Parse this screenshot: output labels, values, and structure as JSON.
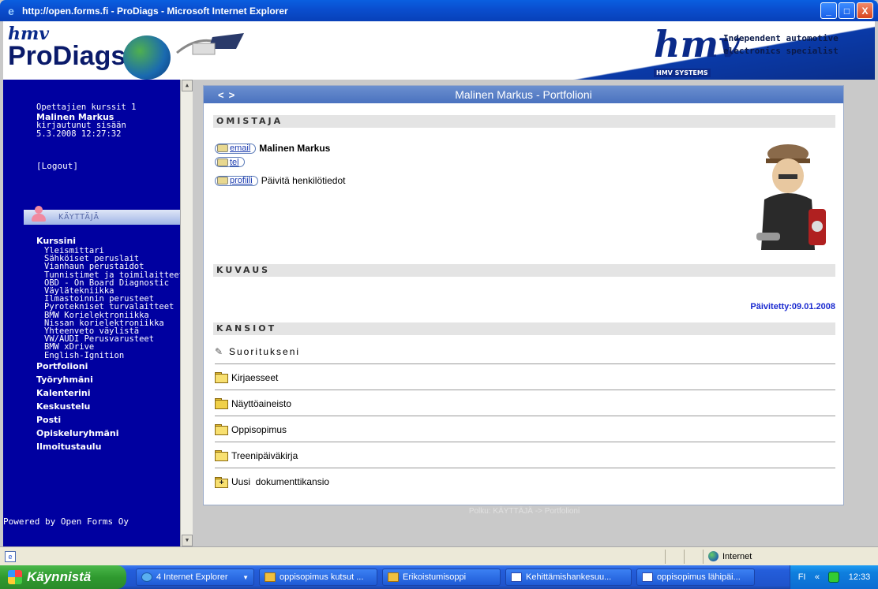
{
  "window": {
    "title": "http://open.forms.fi - ProDiags - Microsoft Internet Explorer",
    "buttons": {
      "minimize": "_",
      "maximize": "□",
      "close": "X"
    }
  },
  "banner": {
    "logo_hmv": "hmv",
    "logo_name": "ProDiags",
    "right_logo": "hmv",
    "right_logo_sub": "HMV SYSTEMS",
    "tagline_1": "Independent automotive",
    "tagline_2": "electronics specialist"
  },
  "sidebar": {
    "course_group": "Opettajien kurssit 1",
    "user_name": "Malinen Markus",
    "login_status": "kirjautunut sisään",
    "login_time": "5.3.2008 12:27:32",
    "logout": "[Logout]",
    "user_section": "KÄYTTÄJÄ",
    "courses_title": "Kurssini",
    "courses": [
      "Yleismittari",
      "Sähköiset peruslait",
      "Vianhaun perustaidot",
      "Tunnistimet ja toimilaitteet",
      "OBD - On Board Diagnostic",
      "Väylätekniikka",
      "Ilmastoinnin perusteet",
      "Pyrotekniset turvalaitteet",
      "BMW Korielektroniikka",
      "Nissan korielektroniikka",
      "Yhteenveto väylistä",
      "VW/AUDI Perusvarusteet",
      "BMW xDrive",
      "English-Ignition"
    ],
    "sections": [
      "Portfolioni",
      "Työryhmäni",
      "Kalenterini",
      "Keskustelu",
      "Posti",
      "Opiskeluryhmäni",
      "Ilmoitustaulu"
    ],
    "powered_by": "Powered by Open Forms Oy"
  },
  "panel": {
    "nav_back": "<",
    "nav_forward": ">",
    "title": "Malinen Markus - Portfolioni",
    "owner_header": "OMISTAJA",
    "email_btn": "email",
    "tel_btn": "tel",
    "profile_btn": "profiili",
    "owner_name": "Malinen Markus",
    "update_profile": "Päivitä henkilötiedot",
    "description_header": "KUVAUS",
    "updated": "Päivitetty:09.01.2008",
    "folders_header": "KANSIOT",
    "folders": [
      {
        "label": "Suoritukseni",
        "icon": "pen-icon"
      },
      {
        "label": "Kirjaesseet",
        "icon": "folder-icon"
      },
      {
        "label": "Näyttöaineisto",
        "icon": "folder-icon"
      },
      {
        "label": "Oppisopimus",
        "icon": "folder-icon"
      },
      {
        "label": "Treenipäiväkirja",
        "icon": "folder-icon"
      },
      {
        "label": "Uusi  dokumenttikansio",
        "icon": "new-folder-icon"
      }
    ],
    "breadcrumb": "Polku: KÄYTTÄJÄ -> Portfolioni"
  },
  "statusbar": {
    "zone": "Internet"
  },
  "taskbar": {
    "start": "Käynnistä",
    "tasks": [
      "4 Internet Explorer",
      "oppisopimus kutsut ...",
      "Erikoistumisoppi",
      "Kehittämishankesuu...",
      "oppisopimus lähipäi..."
    ],
    "lang": "FI",
    "clock": "12:33"
  }
}
